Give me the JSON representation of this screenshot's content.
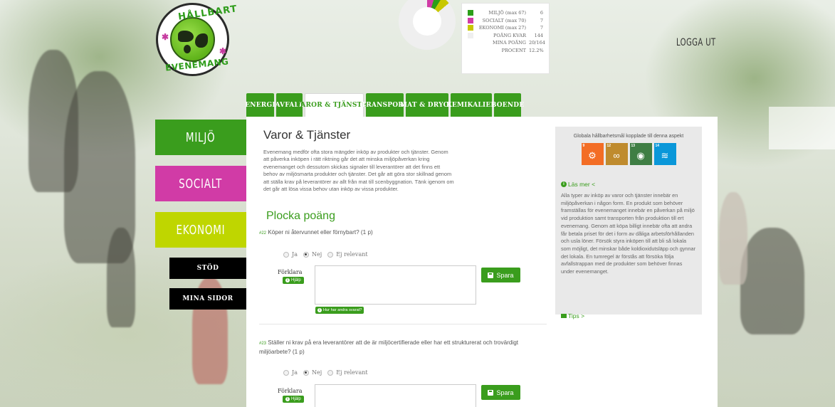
{
  "logo": {
    "top_text": "HÅLLBART",
    "bottom_text": "EVENEMANG"
  },
  "stats": {
    "rows": [
      {
        "label": "MILJÖ (max 67)",
        "value": "6",
        "color": "#2c9e19"
      },
      {
        "label": "SOCIALT (max 70)",
        "value": "7",
        "color": "#d13ba6"
      },
      {
        "label": "EKONOMI (max 27)",
        "value": "7",
        "color": "#c8c800"
      },
      {
        "label": "POÄNG KVAR",
        "value": "144",
        "color": "#efefef"
      },
      {
        "label": "MINA POÄNG",
        "value": "20/164",
        "color": ""
      },
      {
        "label": "PROCENT",
        "value": "12.2%",
        "color": ""
      }
    ]
  },
  "header": {
    "logout": "LOGGA UT"
  },
  "tabs": [
    {
      "label": "ENERGI",
      "active": false
    },
    {
      "label": "AVFALL",
      "active": false
    },
    {
      "label": "VAROR & TJÄNSTER",
      "active": true
    },
    {
      "label": "TRANSPORT",
      "active": false
    },
    {
      "label": "MAT & DRYCK",
      "active": false
    },
    {
      "label": "KEMIKALIER",
      "active": false
    },
    {
      "label": "BOENDE",
      "active": false
    }
  ],
  "leftnav": {
    "miljo": "MILJÖ",
    "socialt": "SOCIALT",
    "ekonomi": "EKONOMI",
    "stod": "STÖD",
    "mina_sidor": "MINA SIDOR"
  },
  "colors": {
    "green": "#3a9d1d",
    "magenta": "#d13ba6",
    "lime": "#bfd600",
    "black": "#000000"
  },
  "main": {
    "title": "Varor & Tjänster",
    "intro": "Evenemang medför ofta stora mängder inköp av produkter och tjänster. Genom att påverka inköpen i rätt riktning går det att minska miljöpåverkan kring evenemanget och dessutom skickas signaler till leverantörer att det finns ett behov av miljösmarta produkter och tjänster. Det går att göra stor skillnad genom att ställa krav på leverantörer av allt från mat till scenbyggnation. Tänk igenom om det går att lösa vissa behov utan inköp av vissa produkter.",
    "section_title": "Plocka poäng",
    "options": {
      "ja": "Ja",
      "nej": "Nej",
      "ej": "Ej relevant"
    },
    "forklara": "Förklara",
    "hjalp": "Hjälp",
    "spara": "Spara",
    "hur": "Hur har andra svarat?",
    "questions": [
      {
        "num": "#22",
        "text": "Köper ni återvunnet eller förnybart? (1 p)"
      },
      {
        "num": "#23",
        "text": "Ställer ni krav på era leverantörer att de är miljöcertifierade eller har ett strukturerat och trovärdigt miljöarbete? (1 p)"
      }
    ]
  },
  "side": {
    "goals_title": "Globala hållbarhetsmål kopplade till denna aspekt",
    "goals": [
      {
        "num": "9",
        "color": "#f36d25",
        "icon": "factory-icon"
      },
      {
        "num": "12",
        "color": "#bf8b2e",
        "icon": "infinity-icon"
      },
      {
        "num": "13",
        "color": "#3f7e44",
        "icon": "climate-eye-icon"
      },
      {
        "num": "14",
        "color": "#0a97d9",
        "icon": "fish-icon"
      }
    ],
    "lasmer": "Läs mer <",
    "body": "Alla typer av inköp av varor och tjänster innebär en miljöpåverkan i någon form. En produkt som behöver framställas för evenemanget innebär en påverkan på miljö vid produktion samt transporten från produktion till ert evenemang. Genom att köpa billigt innebär ofta att andra får betala priset för det i form av dåliga arbetsförhållanden och usla löner. Försök styra inköpen till att bli så lokala som möjligt, det minskar både koldioxidutsläpp och gynnar det lokala. En tumregel är förstås att försöka följa avfallstrappan med de produkter som behöver finnas under evenemanget.",
    "tips": "Tips >"
  }
}
